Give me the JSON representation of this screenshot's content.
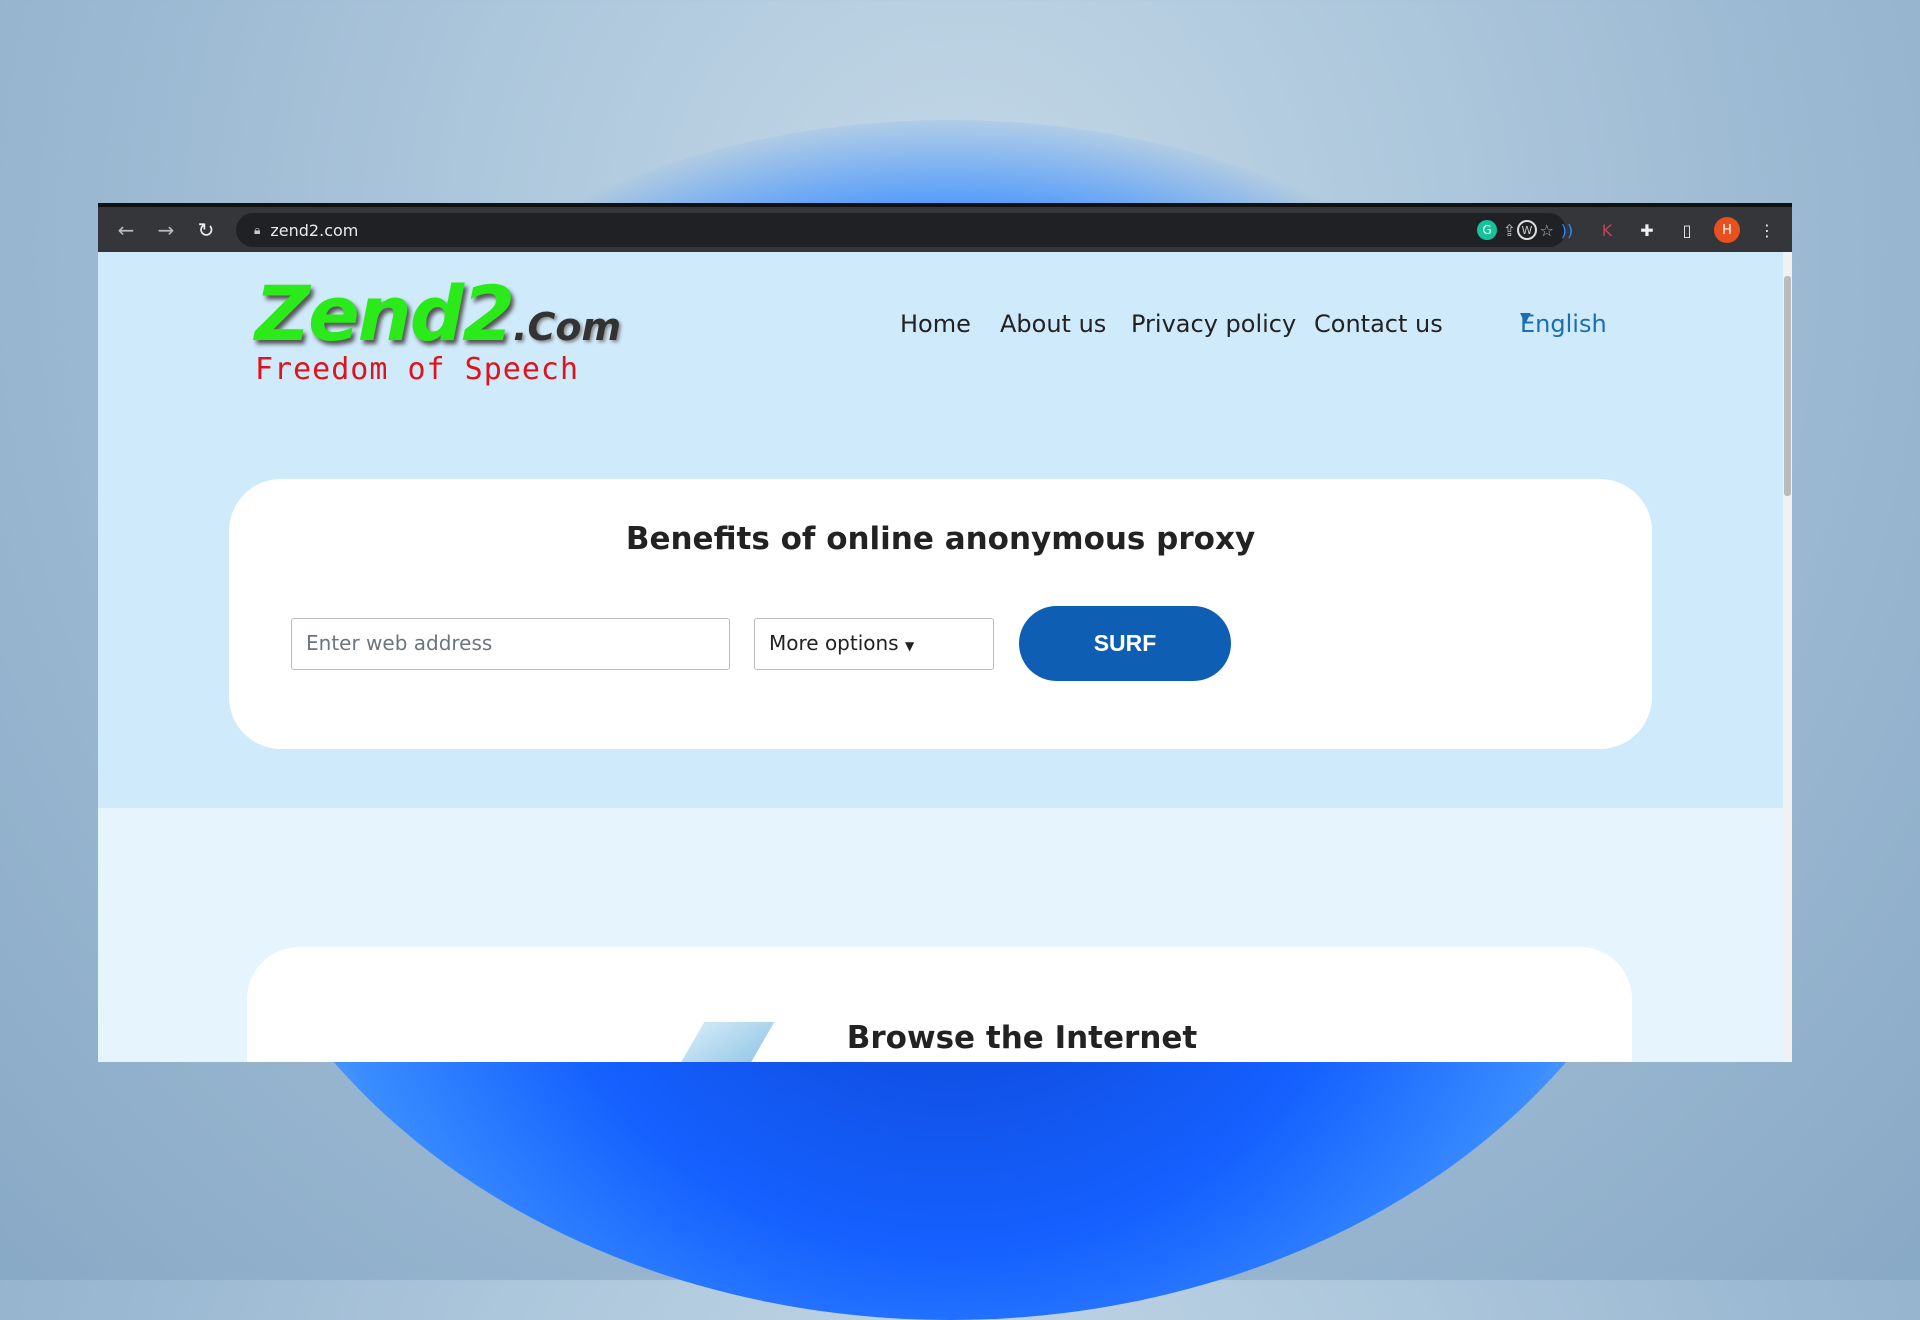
{
  "browser": {
    "url": "zend2.com",
    "avatar_letter": "H",
    "extensions": [
      "grammarly-icon",
      "w-icon",
      "sound-icon",
      "k-icon",
      "puzzle-icon",
      "sidebar-icon"
    ]
  },
  "logo": {
    "name": "Zend2",
    "suffix": ".Com",
    "tagline": "Freedom of Speech"
  },
  "nav": {
    "items": [
      "Home",
      "About us",
      "Privacy policy",
      "Contact us"
    ],
    "language": "English"
  },
  "proxy": {
    "title": "Benefits of online anonymous proxy",
    "input_placeholder": "Enter web address",
    "options_label": "More options",
    "submit_label": "SURF"
  },
  "section2": {
    "title": "Browse the Internet"
  },
  "colors": {
    "accent": "#0e5fb4",
    "logo_green": "#2bea1a",
    "tagline_red": "#e0121c"
  }
}
